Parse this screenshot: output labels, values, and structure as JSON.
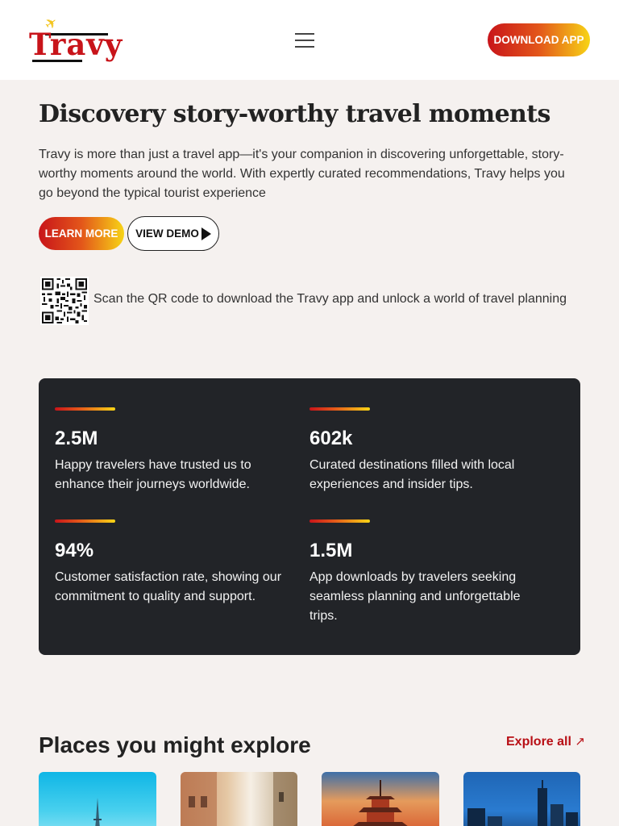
{
  "header": {
    "logo_text": "Travy",
    "logo_icon": "airplane-icon",
    "menu_icon": "hamburger-icon",
    "download_label": "DOWNLOAD APP"
  },
  "hero": {
    "title": "Discovery story-worthy travel moments",
    "description": "Travy is more than just a travel app—it's your companion in discovering unforgettable, story-worthy moments around the world. With expertly curated recommendations, Travy helps you go beyond the typical tourist experience",
    "learn_more_label": "LEARN MORE",
    "view_demo_label": "VIEW DEMO"
  },
  "qr": {
    "text": "Scan the QR code to download the Travy app and unlock a world of travel planning"
  },
  "stats": [
    {
      "value": "2.5M",
      "description": "Happy travelers have trusted us to enhance their journeys worldwide."
    },
    {
      "value": "602k",
      "description": "Curated destinations filled with local experiences and insider tips."
    },
    {
      "value": "94%",
      "description": "Customer satisfaction rate, showing our commitment to quality and support."
    },
    {
      "value": "1.5M",
      "description": "App downloads by travelers seeking seamless planning and unforgettable trips."
    }
  ],
  "places": {
    "title": "Places you might explore",
    "explore_label": "Explore all",
    "explore_icon": "↗"
  },
  "colors": {
    "brand_red": "#c8141a",
    "brand_yellow": "#f7d416",
    "panel_dark": "#222428",
    "page_bg": "#f5f1ef"
  }
}
